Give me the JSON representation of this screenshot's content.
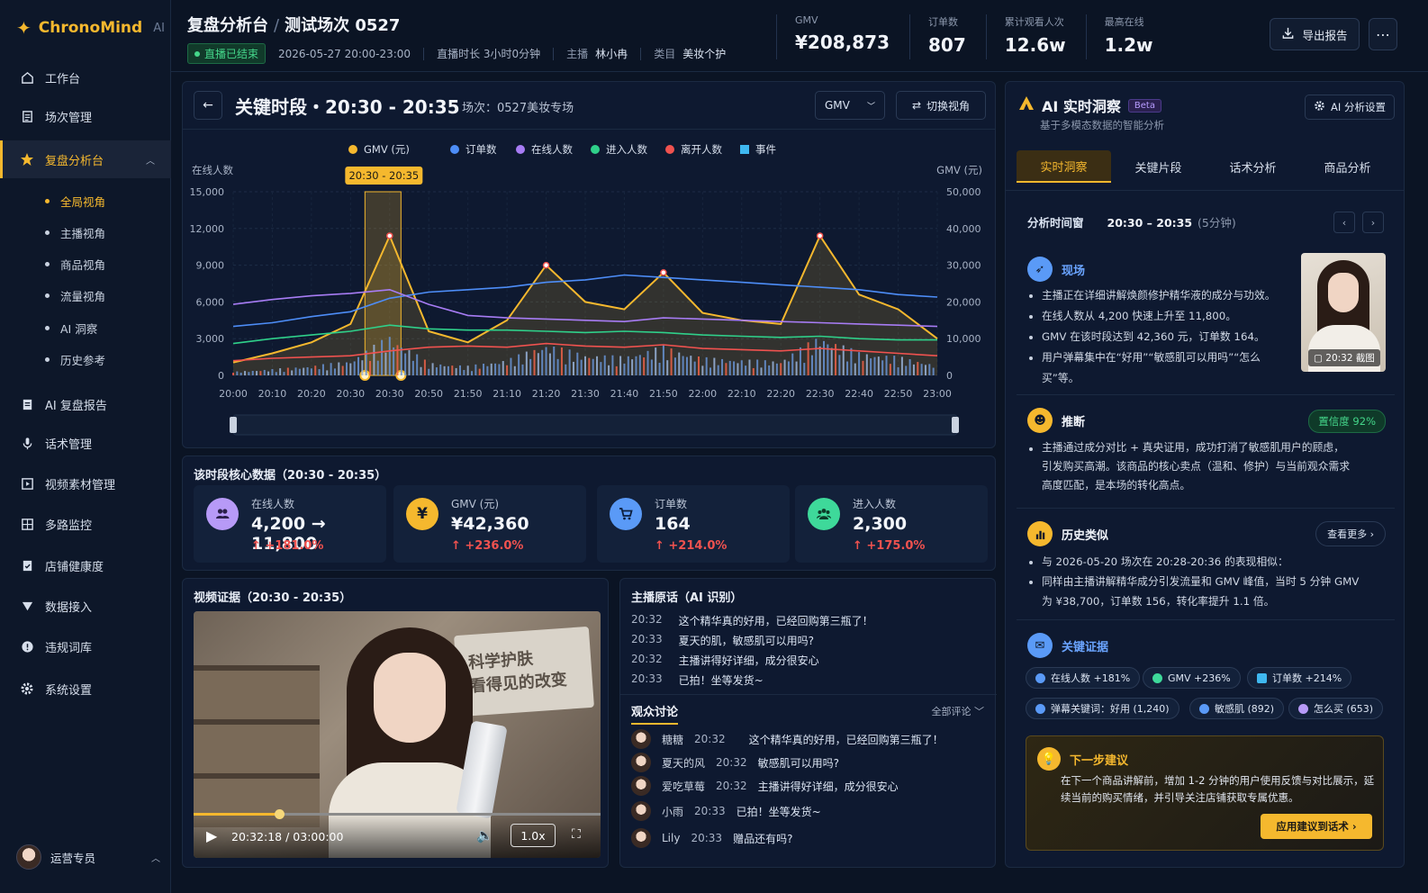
{
  "app": {
    "name": "ChronoMind",
    "suffix": "AI"
  },
  "sidebar": {
    "items": [
      {
        "label": "工作台"
      },
      {
        "label": "场次管理"
      },
      {
        "label": "复盘分析台"
      },
      {
        "label": "AI 复盘报告"
      },
      {
        "label": "话术管理"
      },
      {
        "label": "视频素材管理"
      },
      {
        "label": "多路监控"
      },
      {
        "label": "店铺健康度"
      },
      {
        "label": "数据接入"
      },
      {
        "label": "违规词库"
      },
      {
        "label": "系统设置"
      }
    ],
    "sub_items": [
      {
        "label": "全局视角"
      },
      {
        "label": "主播视角"
      },
      {
        "label": "商品视角"
      },
      {
        "label": "流量视角"
      },
      {
        "label": "AI 洞察"
      },
      {
        "label": "历史参考"
      }
    ],
    "user": "运营专员"
  },
  "header": {
    "title": "复盘分析台",
    "subtitle": "测试场次 0527",
    "status": "直播已结束",
    "datetime": "2026-05-27 20:00-23:00",
    "duration": "直播时长 3小时0分钟",
    "host_label": "主播",
    "host": "林小冉",
    "category_label": "类目",
    "category": "美妆个护",
    "kpis": [
      {
        "label": "GMV",
        "value": "¥208,873"
      },
      {
        "label": "订单数",
        "value": "807"
      },
      {
        "label": "累计观看人次",
        "value": "12.6w"
      },
      {
        "label": "最高在线",
        "value": "1.2w"
      }
    ],
    "export": "导出报告"
  },
  "segment": {
    "title": "关键时段・20:30 - 20:35",
    "session": "场次：0527美妆专场",
    "metric": "GMV",
    "switch": "切换视角"
  },
  "chart_data": {
    "type": "line",
    "title": "",
    "ylabel_left": "在线人数",
    "ylabel_right": "GMV (元)",
    "highlight_label": "20:30 - 20:35",
    "x": [
      "20:00",
      "20:10",
      "20:20",
      "20:30",
      "20:30",
      "20:50",
      "21:50",
      "21:10",
      "21:20",
      "21:30",
      "21:40",
      "21:50",
      "22:00",
      "22:10",
      "22:20",
      "22:30",
      "22:40",
      "22:50",
      "23:00"
    ],
    "y_left_ticks": [
      "0",
      "3,000",
      "6,000",
      "9,000",
      "12,000",
      "15,000"
    ],
    "y_right_ticks": [
      "0",
      "10,000",
      "20,000",
      "30,000",
      "40,000",
      "50,000"
    ],
    "ylim_left": [
      0,
      15000
    ],
    "ylim_right": [
      0,
      50000
    ],
    "legend": [
      {
        "name": "GMV (元)",
        "color": "#f5b82e"
      },
      {
        "name": "订单数",
        "color": "#4d8df7"
      },
      {
        "name": "在线人数",
        "color": "#a77cf4"
      },
      {
        "name": "进入人数",
        "color": "#2fd08a"
      },
      {
        "name": "离开人数",
        "color": "#f0524f"
      },
      {
        "name": "事件",
        "color": "#3fb8f0"
      }
    ],
    "series": [
      {
        "name": "GMV (元)",
        "axis": "right",
        "values": [
          3500,
          6000,
          9000,
          14000,
          38000,
          12000,
          9000,
          15000,
          30000,
          20000,
          18000,
          28000,
          17000,
          15000,
          14000,
          38000,
          22000,
          18000,
          10000
        ]
      },
      {
        "name": "订单数",
        "axis": "left",
        "values": [
          4000,
          4300,
          4800,
          5200,
          6300,
          6800,
          7000,
          7200,
          7600,
          7800,
          8200,
          8000,
          7800,
          7600,
          7400,
          7200,
          7000,
          6600,
          6400
        ]
      },
      {
        "name": "在线人数",
        "axis": "left",
        "values": [
          5800,
          6200,
          6500,
          6700,
          7000,
          5800,
          4900,
          4700,
          4600,
          4500,
          4400,
          4700,
          4600,
          4500,
          4400,
          4300,
          4200,
          4100,
          4000
        ]
      },
      {
        "name": "进入人数",
        "axis": "left",
        "values": [
          2600,
          3000,
          3300,
          3600,
          4100,
          3800,
          3700,
          3700,
          3600,
          3500,
          3600,
          3500,
          3300,
          3200,
          3100,
          3200,
          3000,
          2900,
          2900
        ]
      },
      {
        "name": "离开人数",
        "axis": "left",
        "values": [
          1200,
          1400,
          1500,
          1600,
          2000,
          2300,
          2400,
          2300,
          2600,
          2400,
          2300,
          2500,
          2200,
          2100,
          2000,
          2200,
          2000,
          1800,
          1600
        ]
      }
    ],
    "grid": true,
    "legend_position": "top"
  },
  "core": {
    "title": "该时段核心数据（20:30 - 20:35）",
    "cards": [
      {
        "label": "在线人数",
        "value": "4,200 → 11,800",
        "delta": "↑ +181.0%",
        "icon": "people-icon",
        "color": "#b79af7"
      },
      {
        "label": "GMV (元)",
        "value": "¥42,360",
        "delta": "↑ +236.0%",
        "icon": "yen-icon",
        "color": "#f5b82e",
        "glyph": "¥"
      },
      {
        "label": "订单数",
        "value": "164",
        "delta": "↑ +214.0%",
        "icon": "cart-icon",
        "color": "#5a9af7"
      },
      {
        "label": "进入人数",
        "value": "2,300",
        "delta": "↑ +175.0%",
        "icon": "group-icon",
        "color": "#3ed99a"
      }
    ]
  },
  "video": {
    "title": "视频证据（20:30 - 20:35）",
    "sign_line1": "科学护肤",
    "sign_line2": "看得见的改变",
    "time": "20:32:18  /  03:00:00",
    "progress": 0.21,
    "speed": "1.0x"
  },
  "transcript": {
    "title": "主播原话（AI 识别）",
    "lines": [
      {
        "time": "20:32",
        "text": "这个精华真的好用，已经回购第三瓶了！"
      },
      {
        "time": "20:33",
        "text": "夏天的肌，敏感肌可以用吗?"
      },
      {
        "time": "20:32",
        "text": "主播讲得好详细，成分很安心"
      },
      {
        "time": "20:33",
        "text": "已拍！坐等发货~"
      }
    ]
  },
  "audience": {
    "tab": "观众讨论",
    "filter": "全部评论",
    "comments": [
      {
        "user": "糖糖",
        "time": "20:32",
        "text": "这个精华真的好用，已经回购第三瓶了！"
      },
      {
        "user": "夏天的风",
        "time": "20:32",
        "text": "敏感肌可以用吗?"
      },
      {
        "user": "爱吃草莓",
        "time": "20:32",
        "text": "主播讲得好详细，成分很安心"
      },
      {
        "user": "小雨",
        "time": "20:33",
        "text": "已拍！坐等发货~"
      },
      {
        "user": "Lily",
        "time": "20:33",
        "text": "赠品还有吗?"
      }
    ]
  },
  "ai": {
    "title": "AI 实时洞察",
    "beta": "Beta",
    "subtitle": "基于多模态数据的智能分析",
    "settings": "AI 分析设置",
    "tabs": [
      {
        "label": "实时洞察"
      },
      {
        "label": "关键片段"
      },
      {
        "label": "话术分析"
      },
      {
        "label": "商品分析"
      }
    ],
    "window_label": "分析时间窗",
    "window_value": "20:30 – 20:35",
    "window_note": "(5分钟)",
    "scene": {
      "title": "现场",
      "bullets": [
        "主播正在详细讲解焕颜修护精华液的成分与功效。",
        "在线人数从 4,200 快速上升至 11,800。",
        "GMV 在该时段达到 42,360 元，订单数 164。",
        "用户弹幕集中在“好用”“敏感肌可以用吗”“怎么买”等。"
      ],
      "thumb_tag": "20:32 截图"
    },
    "inference": {
      "title": "推断",
      "confidence": "置信度  92%",
      "text": "主播通过成分对比 + 真央证用，成功打消了敏感肌用户的顾虑，引发购买高潮。该商品的核心卖点（温和、修护）与当前观众需求高度匹配，是本场的转化高点。"
    },
    "history": {
      "title": "历史类似",
      "more": "查看更多 ›",
      "bullets": [
        "与 2026-05-20 场次在 20:28-20:36 的表现相似：",
        "同样由主播讲解精华成分引发流量和 GMV 峰值，当时 5 分钟 GMV 为 ¥38,700，订单数 156，转化率提升 1.1 倍。"
      ]
    },
    "evidence": {
      "title": "关键证据",
      "chips": [
        {
          "label": "在线人数 +181%",
          "color": "#5a9af7"
        },
        {
          "label": "GMV +236%",
          "color": "#3ed99a"
        },
        {
          "label": "订单数 +214%",
          "color": "#3fb8f0"
        },
        {
          "label": "弹幕关键词：好用 (1,240)",
          "color": "#5a9af7"
        },
        {
          "label": "敏感肌 (892)",
          "color": "#5a9af7"
        },
        {
          "label": "怎么买 (653)",
          "color": "#b79af7"
        }
      ]
    },
    "suggestion": {
      "title": "下一步建议",
      "text": "在下一个商品讲解前，增加 1-2 分钟的用户使用反馈与对比展示，延续当前的购买情绪，并引导关注店铺获取专属优惠。",
      "button": "应用建议到话术 ›"
    }
  }
}
